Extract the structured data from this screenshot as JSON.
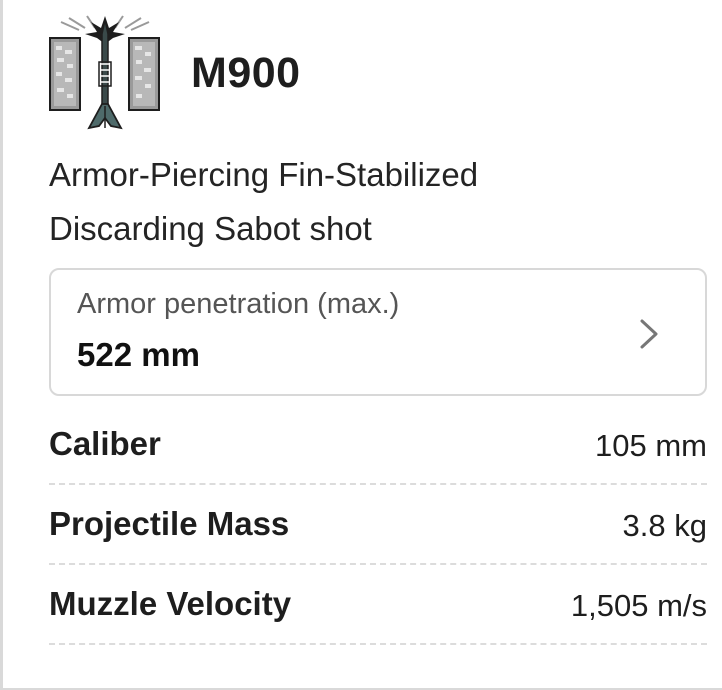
{
  "ammo": {
    "icon": "apfsds-shell-icon",
    "name": "M900",
    "description_line1": "Armor-Piercing Fin-Stabilized",
    "description_line2": "Discarding Sabot shot"
  },
  "penetration": {
    "label": "Armor penetration (max.)",
    "value": "522 mm",
    "icon": "chevron-right-icon"
  },
  "stats": [
    {
      "label": "Caliber",
      "value": "105 mm"
    },
    {
      "label": "Projectile Mass",
      "value": "3.8 kg"
    },
    {
      "label": "Muzzle Velocity",
      "value": "1,505 m/s"
    }
  ]
}
